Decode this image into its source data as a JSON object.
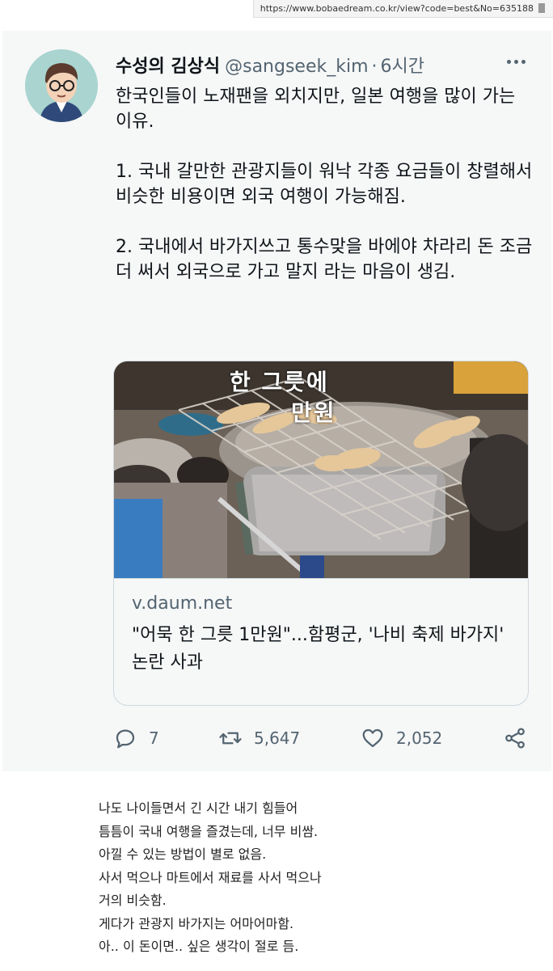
{
  "browser": {
    "url": "https://www.bobaedream.co.kr/view?code=best&No=635188"
  },
  "tweet": {
    "display_name": "수성의 김상식",
    "handle": "@sangseek_kim",
    "separator": "·",
    "time": "6시간",
    "paragraphs": [
      "한국인들이 노재팬을 외치지만, 일본 여행을 많이 가는 이유.",
      "1. 국내 갈만한 관광지들이 워낙 각종 요금들이 창렬해서 비슷한 비용이면 외국 여행이 가능해짐.",
      "2. 국내에서 바가지쓰고 통수맞을 바에야 차라리 돈 조금 더 써서 외국으로 가고 말지 라는 마음이 생김."
    ],
    "link_card": {
      "image_caption_line1": "한 그릇에",
      "image_caption_line2": "만원",
      "domain": "v.daum.net",
      "title": "\"어묵 한 그릇 1만원\"...함평군, '나비 축제 바가지' 논란 사과"
    },
    "actions": {
      "replies": "7",
      "retweets": "5,647",
      "likes": "2,052"
    },
    "colors": {
      "text": "#0f1419",
      "secondary": "#536471",
      "card_bg": "#f6f7f7",
      "border": "#cfd9de"
    }
  },
  "comment": {
    "lines": [
      "나도 나이들면서 긴 시간 내기 힘들어",
      "틈틈이 국내 여행을 즐겼는데, 너무 비쌈.",
      "아낄 수 있는 방법이 별로 없음.",
      "사서 먹으나 마트에서 재료를 사서 먹으나",
      "거의 비슷함.",
      "게다가 관광지 바가지는 어마어마함.",
      "아.. 이 돈이면.. 싶은 생각이 절로 듬."
    ]
  }
}
